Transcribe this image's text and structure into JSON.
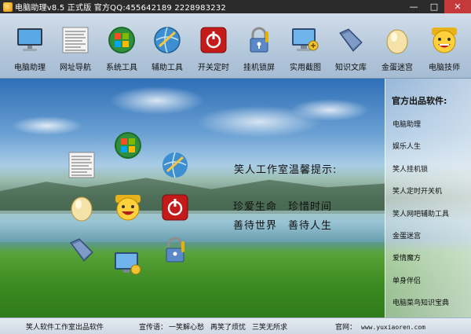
{
  "window": {
    "title": "电脑助理v8.5 正式版  官方QQ:455642189  2228983232",
    "buttons": {
      "minimize": "—",
      "maximize": "□",
      "close": "✕"
    }
  },
  "toolbar": {
    "items": [
      {
        "label": "电脑助理",
        "icon": "monitor-icon"
      },
      {
        "label": "网址导航",
        "icon": "document-icon"
      },
      {
        "label": "系统工具",
        "icon": "windows-logo-icon"
      },
      {
        "label": "辅助工具",
        "icon": "globe-icon"
      },
      {
        "label": "开关定时",
        "icon": "power-icon"
      },
      {
        "label": "挂机锁屏",
        "icon": "lock-icon"
      },
      {
        "label": "实用截图",
        "icon": "screenshot-icon"
      },
      {
        "label": "知识文库",
        "icon": "folder-icon"
      },
      {
        "label": "金蛋迷宫",
        "icon": "egg-icon"
      },
      {
        "label": "电脑技师",
        "icon": "smiley-icon"
      }
    ]
  },
  "message": {
    "title": "笑人工作室温馨提示:",
    "line1": [
      "珍爱生命",
      "珍惜时间"
    ],
    "line2": [
      "善待世界",
      "善待人生"
    ]
  },
  "sidebar": {
    "title": "官方出品软件:",
    "items": [
      "电脑助理",
      "娱乐人生",
      "笑人挂机锁",
      "笑人定时开关机",
      "笑人网吧辅助工具",
      "金蛋迷宫",
      "爱情魔方",
      "单身伴侣",
      "电脑菜鸟知识宝典"
    ]
  },
  "statusbar": {
    "left": "笑人软件工作室出品软件",
    "slogan_label": "宣传语：",
    "slogans": [
      "一笑解心愁",
      "再笑了烦忧",
      "三笑无所求"
    ],
    "site_label": "官网：",
    "site_url": "www.yuxiaoren.com"
  },
  "colors": {
    "titlebar": "#2b2b2b",
    "close_button": "#c43a3a",
    "toolbar_top": "#d2dde9",
    "toolbar_bottom": "#a6bcd2"
  }
}
